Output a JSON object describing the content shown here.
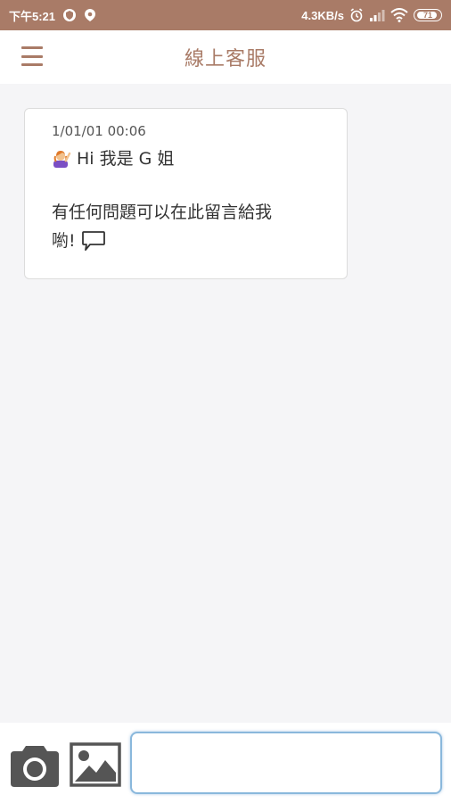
{
  "status_bar": {
    "time": "下午5:21",
    "net_speed": "4.3KB/s",
    "battery": "71",
    "bg_color": "#a97b67"
  },
  "header": {
    "title": "線上客服",
    "menu_icon": "hamburger-menu-icon",
    "accent_color": "#a97b67"
  },
  "chat": {
    "messages": [
      {
        "timestamp": "1/01/01 00:06",
        "avatar_emoji": "woman-raising-hand-emoji",
        "greeting": "Hi 我是 G 姐",
        "line1": "有任何問題可以在此留言給我",
        "line2": "喲!",
        "trailing_icon": "speech-bubble-icon"
      }
    ]
  },
  "input_bar": {
    "camera_icon": "camera-icon",
    "image_icon": "image-icon",
    "input_value": "",
    "input_placeholder": ""
  }
}
